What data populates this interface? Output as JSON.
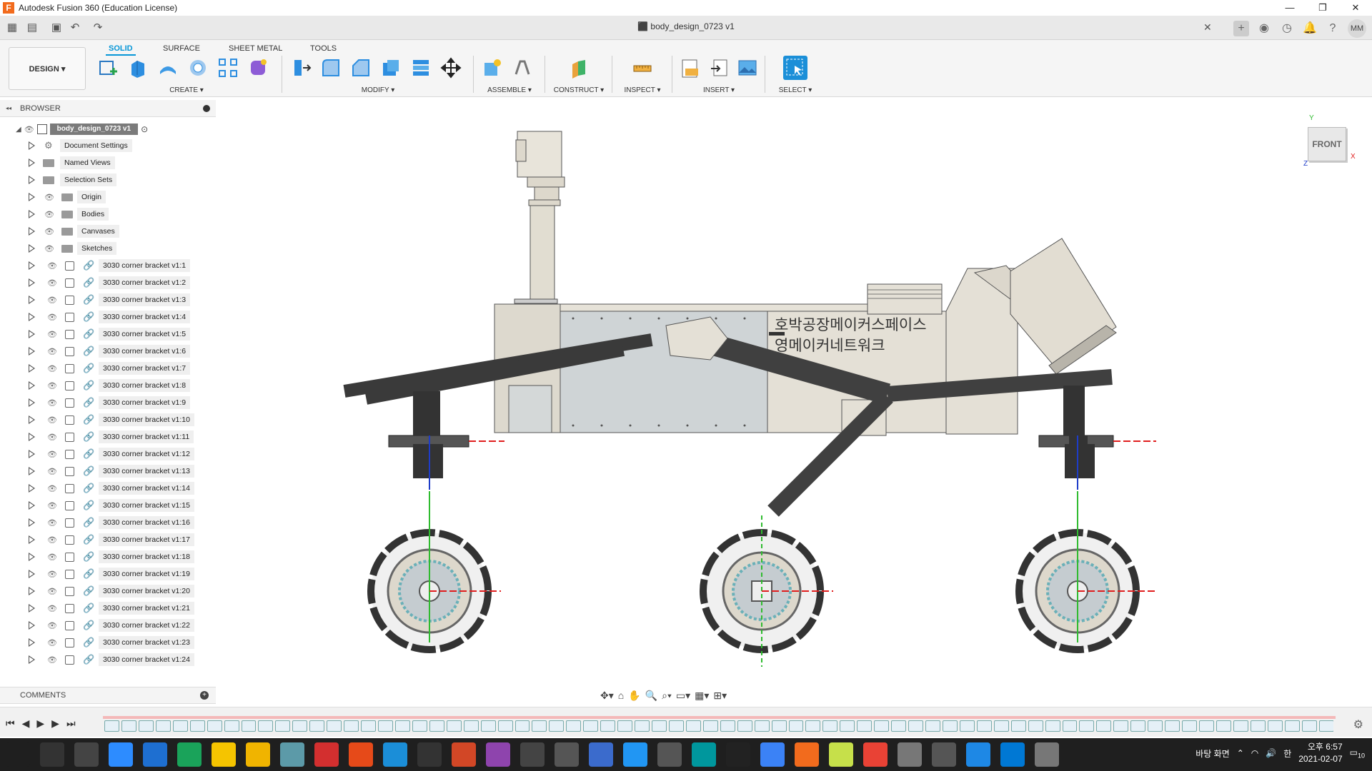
{
  "window": {
    "title": "Autodesk Fusion 360 (Education License)",
    "logo": "F"
  },
  "document": {
    "tab_title": "body_design_0723 v1"
  },
  "user": {
    "initials": "MM"
  },
  "tabs": [
    "SOLID",
    "SURFACE",
    "SHEET METAL",
    "TOOLS"
  ],
  "workspace": {
    "label": "DESIGN ▾"
  },
  "groups": [
    {
      "label": "CREATE ▾"
    },
    {
      "label": "MODIFY ▾"
    },
    {
      "label": "ASSEMBLE ▾"
    },
    {
      "label": "CONSTRUCT ▾"
    },
    {
      "label": "INSPECT ▾"
    },
    {
      "label": "INSERT ▾"
    },
    {
      "label": "SELECT ▾"
    }
  ],
  "browser": {
    "title": "BROWSER",
    "root": "body_design_0723 v1",
    "folders": [
      "Document Settings",
      "Named Views",
      "Selection Sets",
      "Origin",
      "Bodies",
      "Canvases",
      "Sketches"
    ],
    "components": [
      "3030 corner bracket v1:1",
      "3030 corner bracket v1:2",
      "3030 corner bracket v1:3",
      "3030 corner bracket v1:4",
      "3030 corner bracket v1:5",
      "3030 corner bracket v1:6",
      "3030 corner bracket v1:7",
      "3030 corner bracket v1:8",
      "3030 corner bracket v1:9",
      "3030 corner bracket v1:10",
      "3030 corner bracket v1:11",
      "3030 corner bracket v1:12",
      "3030 corner bracket v1:13",
      "3030 corner bracket v1:14",
      "3030 corner bracket v1:15",
      "3030 corner bracket v1:16",
      "3030 corner bracket v1:17",
      "3030 corner bracket v1:18",
      "3030 corner bracket v1:19",
      "3030 corner bracket v1:20",
      "3030 corner bracket v1:21",
      "3030 corner bracket v1:22",
      "3030 corner bracket v1:23",
      "3030 corner bracket v1:24"
    ]
  },
  "comments": {
    "title": "COMMENTS"
  },
  "viewcube": {
    "face": "FRONT",
    "axis_y": "Y",
    "axis_x": "X",
    "axis_z": "Z"
  },
  "model": {
    "text_line1": "호박공장메이커스페이스",
    "text_line2": "영메이커네트워크"
  },
  "taskbar": {
    "ime": "바탕 화면",
    "time": "오후 6:57",
    "date": "2021-02-07",
    "notif": "10"
  }
}
